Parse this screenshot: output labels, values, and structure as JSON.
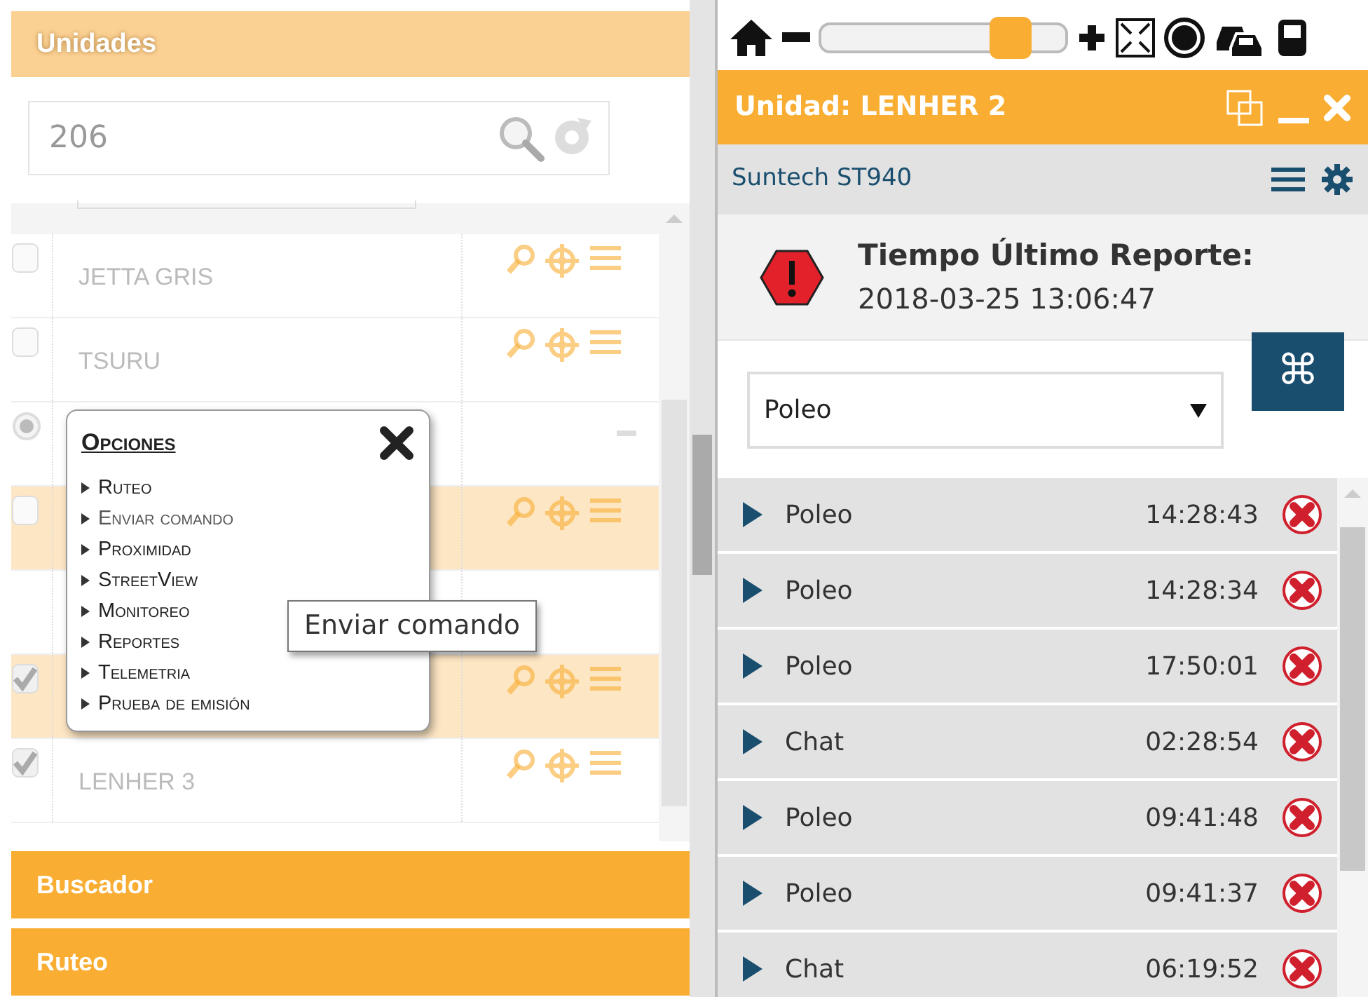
{
  "units_panel": {
    "title": "Unidades",
    "search": {
      "value": "206"
    },
    "rows": [
      {
        "kind": "unit",
        "name": "JETTA GRIS",
        "checked": false,
        "highlighted": false
      },
      {
        "kind": "unit",
        "name": "TSURU",
        "checked": false,
        "highlighted": false
      },
      {
        "kind": "group",
        "checked": true,
        "highlighted": false
      },
      {
        "kind": "unit",
        "checked": false,
        "highlighted": true
      },
      {
        "kind": "blank",
        "highlighted": false
      },
      {
        "kind": "unit",
        "checked": true,
        "highlighted": true
      },
      {
        "kind": "unit",
        "name": "LENHER 3",
        "checked": true,
        "highlighted": false
      }
    ],
    "options_popup": {
      "title": "Opciones",
      "items": [
        "Ruteo",
        "Enviar comando",
        "Proximidad",
        "StreetView",
        "Monitoreo",
        "Reportes",
        "Telemetria",
        "Prueba de emisión"
      ]
    },
    "tooltip": "Enviar comando",
    "sections": [
      "Buscador",
      "Ruteo"
    ]
  },
  "toolbar": {
    "zoom": {
      "level": 0.83
    }
  },
  "unit_window": {
    "title": "Unidad: LENHER 2",
    "device": "Suntech ST940",
    "report_label": "Tiempo Último Reporte:",
    "report_time": "2018-03-25 13:06:47",
    "command_select": {
      "value": "Poleo"
    },
    "command_button": "⌘",
    "events": [
      {
        "name": "Poleo",
        "time": "14:28:43"
      },
      {
        "name": "Poleo",
        "time": "14:28:34"
      },
      {
        "name": "Poleo",
        "time": "17:50:01"
      },
      {
        "name": "Chat",
        "time": "02:28:54"
      },
      {
        "name": "Poleo",
        "time": "09:41:48"
      },
      {
        "name": "Poleo",
        "time": "09:41:37"
      },
      {
        "name": "Chat",
        "time": "06:19:52"
      }
    ]
  }
}
